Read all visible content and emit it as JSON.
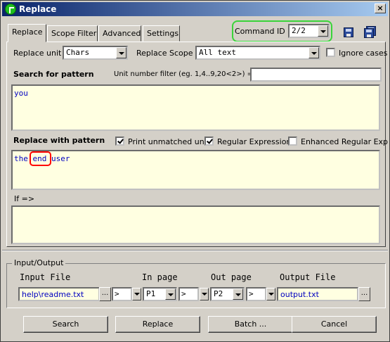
{
  "window": {
    "title": "Replace",
    "close_label": "×"
  },
  "tabs": [
    {
      "label": "Replace"
    },
    {
      "label": "Scope Filter"
    },
    {
      "label": "Advanced"
    },
    {
      "label": "Settings"
    }
  ],
  "command": {
    "label": "Command ID =>",
    "value": "2/2"
  },
  "replace_unit": {
    "label": "Replace unit",
    "value": "Chars"
  },
  "replace_scope": {
    "label": "Replace Scope",
    "value": "All text"
  },
  "ignore_cases": {
    "label": "Ignore cases",
    "checked": false
  },
  "search": {
    "heading": "Search for pattern",
    "unit_filter_label": "Unit number filter (eg. 1,4..9,20<2>) =>",
    "unit_filter_value": "",
    "pattern": "you"
  },
  "replace": {
    "heading": "Replace with pattern",
    "print_unmatched": {
      "label": "Print unmatched units",
      "checked": true
    },
    "regular_expression": {
      "label": "Regular Expression",
      "checked": true
    },
    "enhanced_regex": {
      "label": "Enhanced Regular Exp",
      "checked": false
    },
    "pattern": "the end user"
  },
  "if_section": {
    "label": "If =>",
    "value": ""
  },
  "io": {
    "group_title": "Input/Output",
    "input_file_label": "Input File",
    "in_page_label": "In page",
    "out_page_label": "Out page",
    "output_file_label": "Output File",
    "input_file": "help\\readme.txt",
    "browse_label": "...",
    "in_op": ">",
    "in_page": "P1",
    "mid_op": ">",
    "out_page": "P2",
    "out_op": ">",
    "output_file": "output.txt"
  },
  "buttons": {
    "search": "Search",
    "replace": "Replace",
    "batch": "Batch ...",
    "cancel": "Cancel"
  },
  "colors": {
    "title_start": "#0a246a",
    "title_end": "#a6caf0",
    "highlight_green": "#3ad43a",
    "highlight_red": "#ff0000",
    "pattern_text": "#0000c0",
    "field_bg": "#ffffe1"
  }
}
